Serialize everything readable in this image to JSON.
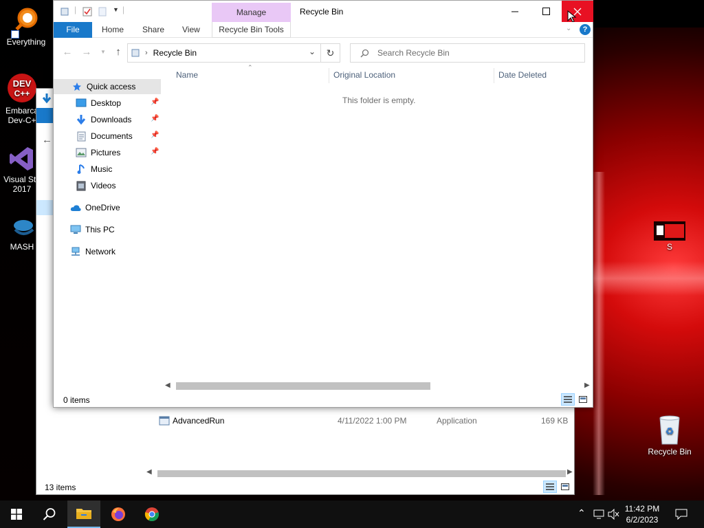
{
  "desktop": {
    "icons": [
      {
        "label": "Everything"
      },
      {
        "label_line1": "Embarca",
        "label_line2": "Dev-C+"
      },
      {
        "label_line1": "Visual Stu",
        "label_line2": "2017"
      },
      {
        "label": "MASH"
      },
      {
        "label": "S"
      },
      {
        "label": "Recycle Bin"
      }
    ]
  },
  "bg_window": {
    "file_row": {
      "name": "AdvancedRun",
      "date": "4/11/2022 1:00 PM",
      "type": "Application",
      "size": "169 KB"
    },
    "status": "13 items"
  },
  "main_window": {
    "title": "Recycle Bin",
    "manage_label": "Manage",
    "ribbon_tabs": {
      "file": "File",
      "home": "Home",
      "share": "Share",
      "view": "View",
      "tools": "Recycle Bin Tools"
    },
    "address": {
      "path": "Recycle Bin"
    },
    "search": {
      "placeholder": "Search Recycle Bin"
    },
    "nav": {
      "quick_access": "Quick access",
      "desktop": "Desktop",
      "downloads": "Downloads",
      "documents": "Documents",
      "pictures": "Pictures",
      "music": "Music",
      "videos": "Videos",
      "onedrive": "OneDrive",
      "this_pc": "This PC",
      "network": "Network"
    },
    "columns": {
      "name": "Name",
      "original_location": "Original Location",
      "date_deleted": "Date Deleted"
    },
    "empty_message": "This folder is empty.",
    "status": "0 items"
  },
  "taskbar": {
    "time": "11:42 PM",
    "date": "6/2/2023"
  },
  "colors": {
    "accent": "#1979ca",
    "manage_tab": "#e9c8f6",
    "close_button": "#e81123",
    "taskbar": "#101010"
  }
}
